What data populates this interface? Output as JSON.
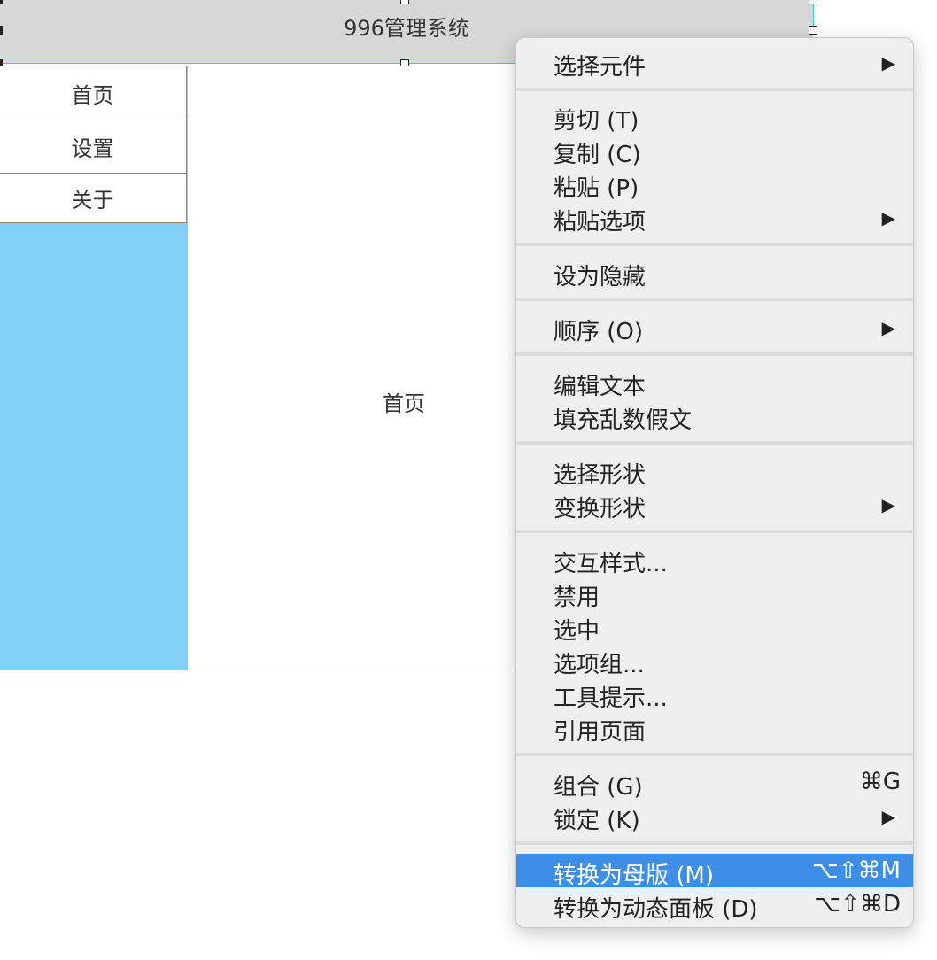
{
  "header": {
    "title": "996管理系统"
  },
  "sidebar": {
    "items": [
      {
        "label": "首页"
      },
      {
        "label": "设置"
      },
      {
        "label": "关于"
      }
    ]
  },
  "content": {
    "title": "首页"
  },
  "context_menu": {
    "groups": [
      [
        {
          "label": "选择元件",
          "submenu": true
        }
      ],
      [
        {
          "label": "剪切 (T)"
        },
        {
          "label": "复制 (C)"
        },
        {
          "label": "粘贴 (P)"
        },
        {
          "label": "粘贴选项",
          "submenu": true
        }
      ],
      [
        {
          "label": "设为隐藏"
        }
      ],
      [
        {
          "label": "顺序 (O)",
          "submenu": true
        }
      ],
      [
        {
          "label": "编辑文本"
        },
        {
          "label": "填充乱数假文"
        }
      ],
      [
        {
          "label": "选择形状"
        },
        {
          "label": "变换形状",
          "submenu": true
        }
      ],
      [
        {
          "label": "交互样式..."
        },
        {
          "label": "禁用"
        },
        {
          "label": "选中"
        },
        {
          "label": "选项组..."
        },
        {
          "label": "工具提示..."
        },
        {
          "label": "引用页面"
        }
      ],
      [
        {
          "label": "组合 (G)",
          "shortcut": "⌘G"
        },
        {
          "label": "锁定 (K)",
          "submenu": true
        }
      ],
      [
        {
          "label": "转换为母版 (M)",
          "shortcut": "⌥⇧⌘M",
          "highlighted": true
        },
        {
          "label": "转换为动态面板 (D)",
          "shortcut": "⌥⇧⌘D"
        }
      ]
    ],
    "submenu_glyph": "▶"
  },
  "colors": {
    "header_bg": "#d7d7d7",
    "sidebar_bg": "#81d0f7",
    "selection_outline": "#2ecfd6",
    "menu_bg": "#efefef",
    "menu_highlight": "#3e8ee8"
  }
}
